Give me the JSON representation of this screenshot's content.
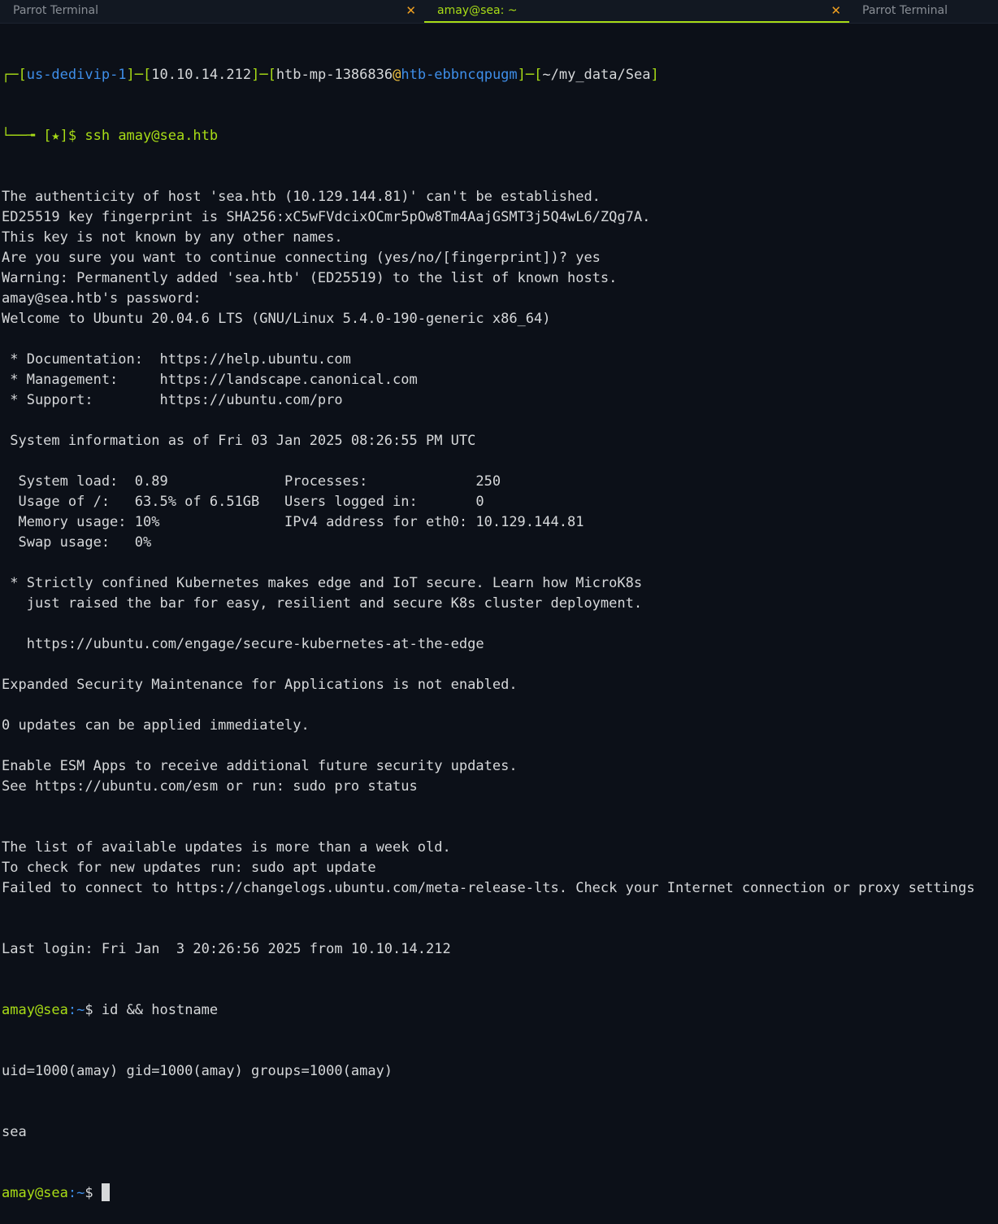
{
  "tabs": [
    {
      "label": "Parrot Terminal",
      "active": false,
      "close": "✕"
    },
    {
      "label": "amay@sea: ~",
      "active": true,
      "close": "✕"
    },
    {
      "label": "Parrot Terminal",
      "active": false
    }
  ],
  "prompt": {
    "host": "us-dedivip-1",
    "ip": "10.10.14.212",
    "user": "htb-mp-1386836",
    "machine": "htb-ebbncqpugm",
    "path": "~/my_data/Sea",
    "marker": "[★]$ ",
    "command": "ssh amay@sea.htb"
  },
  "output1": [
    "The authenticity of host 'sea.htb (10.129.144.81)' can't be established.",
    "ED25519 key fingerprint is SHA256:xC5wFVdcixOCmr5pOw8Tm4AajGSMT3j5Q4wL6/ZQg7A.",
    "This key is not known by any other names.",
    "Are you sure you want to continue connecting (yes/no/[fingerprint])? yes",
    "Warning: Permanently added 'sea.htb' (ED25519) to the list of known hosts.",
    "amay@sea.htb's password: ",
    "Welcome to Ubuntu 20.04.6 LTS (GNU/Linux 5.4.0-190-generic x86_64)",
    "",
    " * Documentation:  https://help.ubuntu.com",
    " * Management:     https://landscape.canonical.com",
    " * Support:        https://ubuntu.com/pro",
    "",
    " System information as of Fri 03 Jan 2025 08:26:55 PM UTC",
    "",
    "  System load:  0.89              Processes:             250",
    "  Usage of /:   63.5% of 6.51GB   Users logged in:       0",
    "  Memory usage: 10%               IPv4 address for eth0: 10.129.144.81",
    "  Swap usage:   0%",
    "",
    " * Strictly confined Kubernetes makes edge and IoT secure. Learn how MicroK8s",
    "   just raised the bar for easy, resilient and secure K8s cluster deployment.",
    "",
    "   https://ubuntu.com/engage/secure-kubernetes-at-the-edge",
    "",
    "Expanded Security Maintenance for Applications is not enabled.",
    "",
    "0 updates can be applied immediately.",
    "",
    "Enable ESM Apps to receive additional future security updates.",
    "See https://ubuntu.com/esm or run: sudo pro status",
    "",
    "",
    "The list of available updates is more than a week old.",
    "To check for new updates run: sudo apt update",
    "Failed to connect to https://changelogs.ubuntu.com/meta-release-lts. Check your Internet connection or proxy settings",
    "",
    "",
    "Last login: Fri Jan  3 20:26:56 2025 from 10.10.14.212"
  ],
  "shell": {
    "user_host": "amay@sea",
    "cwd": ":~",
    "dollar": "$ ",
    "cmd1": "id && hostname",
    "out1": "uid=1000(amay) gid=1000(amay) groups=1000(amay)",
    "out2": "sea"
  }
}
